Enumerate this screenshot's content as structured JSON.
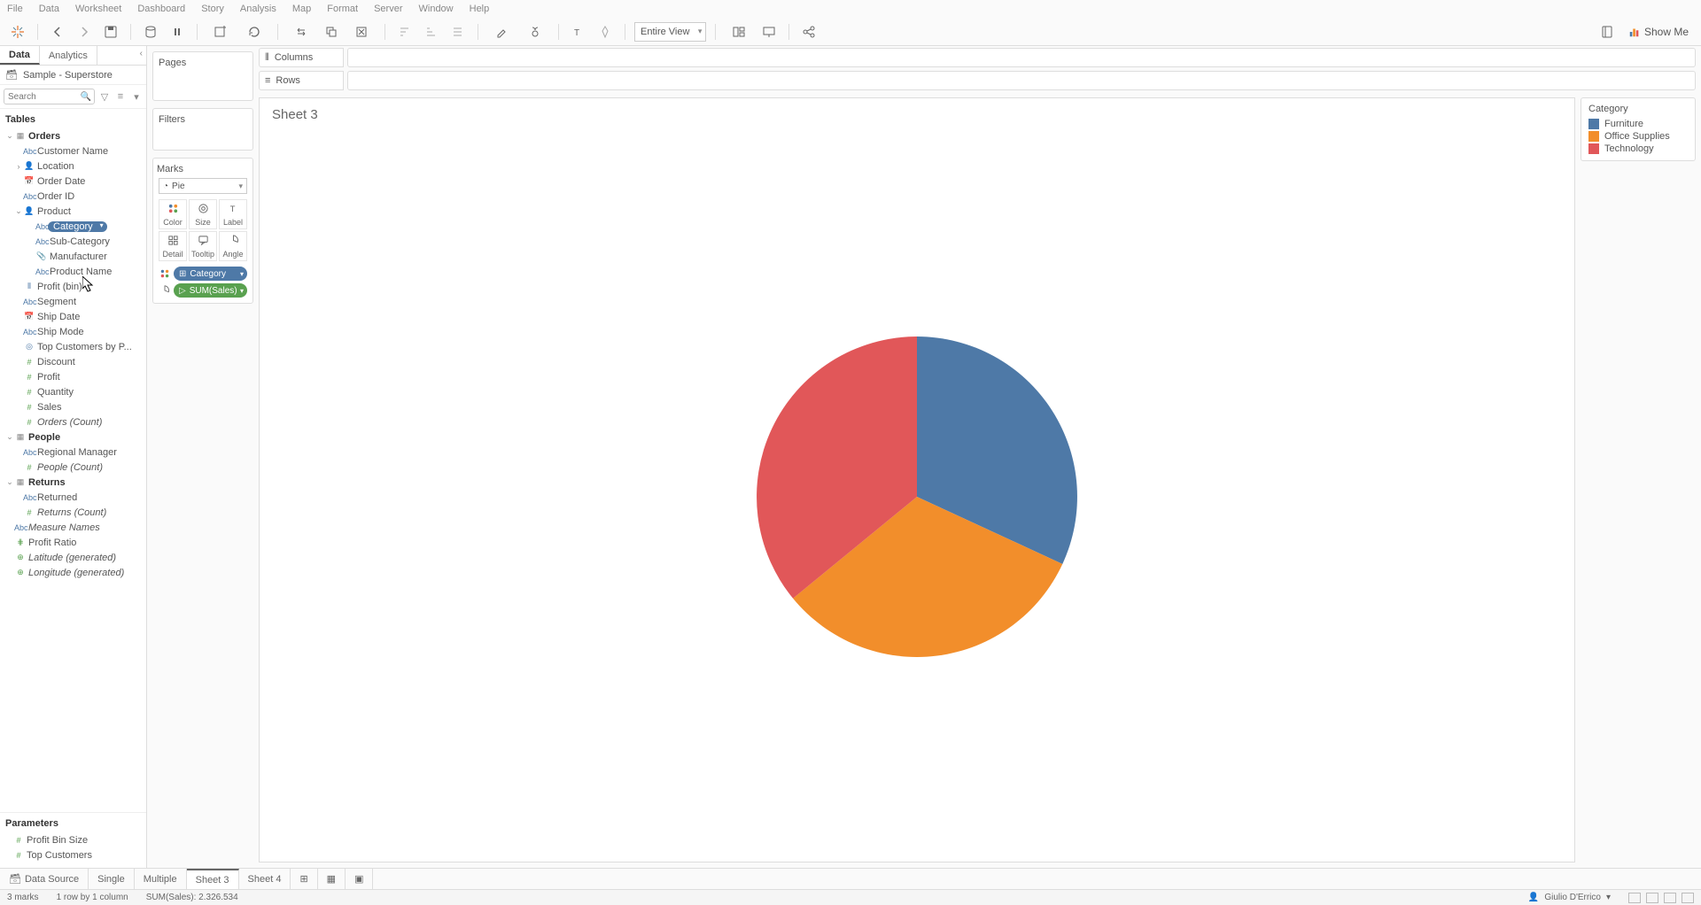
{
  "menu": [
    "File",
    "Data",
    "Worksheet",
    "Dashboard",
    "Story",
    "Analysis",
    "Map",
    "Format",
    "Server",
    "Window",
    "Help"
  ],
  "toolbar": {
    "fit_mode": "Entire View",
    "showme": "Show Me"
  },
  "data_pane": {
    "tabs": {
      "data": "Data",
      "analytics": "Analytics"
    },
    "datasource": "Sample - Superstore",
    "search_placeholder": "Search",
    "tables_label": "Tables",
    "params_label": "Parameters",
    "tree": [
      {
        "lvl": 0,
        "type": "table",
        "label": "Orders",
        "tw": "⌄",
        "icon": "▦"
      },
      {
        "lvl": 1,
        "type": "dim",
        "label": "Customer Name",
        "icon": "Abc"
      },
      {
        "lvl": 1,
        "type": "dim",
        "label": "Location",
        "tw": "›",
        "icon": "👤"
      },
      {
        "lvl": 1,
        "type": "dim",
        "label": "Order Date",
        "icon": "📅"
      },
      {
        "lvl": 1,
        "type": "dim",
        "label": "Order ID",
        "icon": "Abc"
      },
      {
        "lvl": 1,
        "type": "dim",
        "label": "Product",
        "tw": "⌄",
        "icon": "👤"
      },
      {
        "lvl": 2,
        "type": "dim",
        "label": "Category",
        "icon": "Abc",
        "selected": true
      },
      {
        "lvl": 2,
        "type": "dim",
        "label": "Sub-Category",
        "icon": "Abc"
      },
      {
        "lvl": 2,
        "type": "dim",
        "label": "Manufacturer",
        "icon": "📎"
      },
      {
        "lvl": 2,
        "type": "dim",
        "label": "Product Name",
        "icon": "Abc"
      },
      {
        "lvl": 1,
        "type": "dim",
        "label": "Profit (bin)",
        "icon": "⫴"
      },
      {
        "lvl": 1,
        "type": "dim",
        "label": "Segment",
        "icon": "Abc"
      },
      {
        "lvl": 1,
        "type": "dim",
        "label": "Ship Date",
        "icon": "📅"
      },
      {
        "lvl": 1,
        "type": "dim",
        "label": "Ship Mode",
        "icon": "Abc"
      },
      {
        "lvl": 1,
        "type": "dim",
        "label": "Top Customers by P...",
        "icon": "◎"
      },
      {
        "lvl": 1,
        "type": "meas",
        "label": "Discount",
        "icon": "#"
      },
      {
        "lvl": 1,
        "type": "meas",
        "label": "Profit",
        "icon": "#"
      },
      {
        "lvl": 1,
        "type": "meas",
        "label": "Quantity",
        "icon": "#"
      },
      {
        "lvl": 1,
        "type": "meas",
        "label": "Sales",
        "icon": "#"
      },
      {
        "lvl": 1,
        "type": "meas",
        "label": "Orders (Count)",
        "icon": "#",
        "italic": true
      },
      {
        "lvl": 0,
        "type": "table",
        "label": "People",
        "tw": "⌄",
        "icon": "▦"
      },
      {
        "lvl": 1,
        "type": "dim",
        "label": "Regional Manager",
        "icon": "Abc"
      },
      {
        "lvl": 1,
        "type": "meas",
        "label": "People (Count)",
        "icon": "#",
        "italic": true
      },
      {
        "lvl": 0,
        "type": "table",
        "label": "Returns",
        "tw": "⌄",
        "icon": "▦"
      },
      {
        "lvl": 1,
        "type": "dim",
        "label": "Returned",
        "icon": "Abc"
      },
      {
        "lvl": 1,
        "type": "meas",
        "label": "Returns (Count)",
        "icon": "#",
        "italic": true
      },
      {
        "lvl": 0,
        "type": "dim",
        "label": "Measure Names",
        "icon": "Abc",
        "italic": true
      },
      {
        "lvl": 0,
        "type": "meas",
        "label": "Profit Ratio",
        "icon": "⋕"
      },
      {
        "lvl": 0,
        "type": "meas",
        "label": "Latitude (generated)",
        "icon": "⊕",
        "italic": true
      },
      {
        "lvl": 0,
        "type": "meas",
        "label": "Longitude (generated)",
        "icon": "⊕",
        "italic": true
      }
    ],
    "parameters": [
      {
        "label": "Profit Bin Size",
        "icon": "#"
      },
      {
        "label": "Top Customers",
        "icon": "#"
      }
    ]
  },
  "cards": {
    "pages": "Pages",
    "filters": "Filters",
    "marks": "Marks",
    "mark_type": "Pie",
    "mark_cells": [
      "Color",
      "Size",
      "Label",
      "Detail",
      "Tooltip",
      "Angle"
    ],
    "mark_pills": [
      {
        "kind": "dim",
        "glyph": "color",
        "label": "Category",
        "icon": "⊞"
      },
      {
        "kind": "meas",
        "glyph": "angle",
        "label": "SUM(Sales)",
        "icon": "▷"
      }
    ]
  },
  "shelves": {
    "columns": "Columns",
    "rows": "Rows"
  },
  "sheet": {
    "title": "Sheet 3"
  },
  "legend": {
    "title": "Category",
    "items": [
      {
        "label": "Furniture",
        "color": "#4e79a7"
      },
      {
        "label": "Office Supplies",
        "color": "#f28e2b"
      },
      {
        "label": "Technology",
        "color": "#e15759"
      }
    ]
  },
  "chart_data": {
    "type": "pie",
    "title": "Sheet 3",
    "categories": [
      "Furniture",
      "Office Supplies",
      "Technology"
    ],
    "values": [
      742000,
      748534,
      836000
    ],
    "colors": [
      "#4e79a7",
      "#f28e2b",
      "#e15759"
    ],
    "total_label": "SUM(Sales): 2.326.534"
  },
  "bottom_tabs": {
    "data_source": "Data Source",
    "single": "Single",
    "multiple": "Multiple",
    "sheets": [
      "Sheet 3",
      "Sheet 4"
    ],
    "active": "Sheet 3"
  },
  "status": {
    "marks": "3 marks",
    "rows_cols": "1 row by 1 column",
    "sum": "SUM(Sales): 2.326.534",
    "user": "Giulio D'Errico"
  }
}
